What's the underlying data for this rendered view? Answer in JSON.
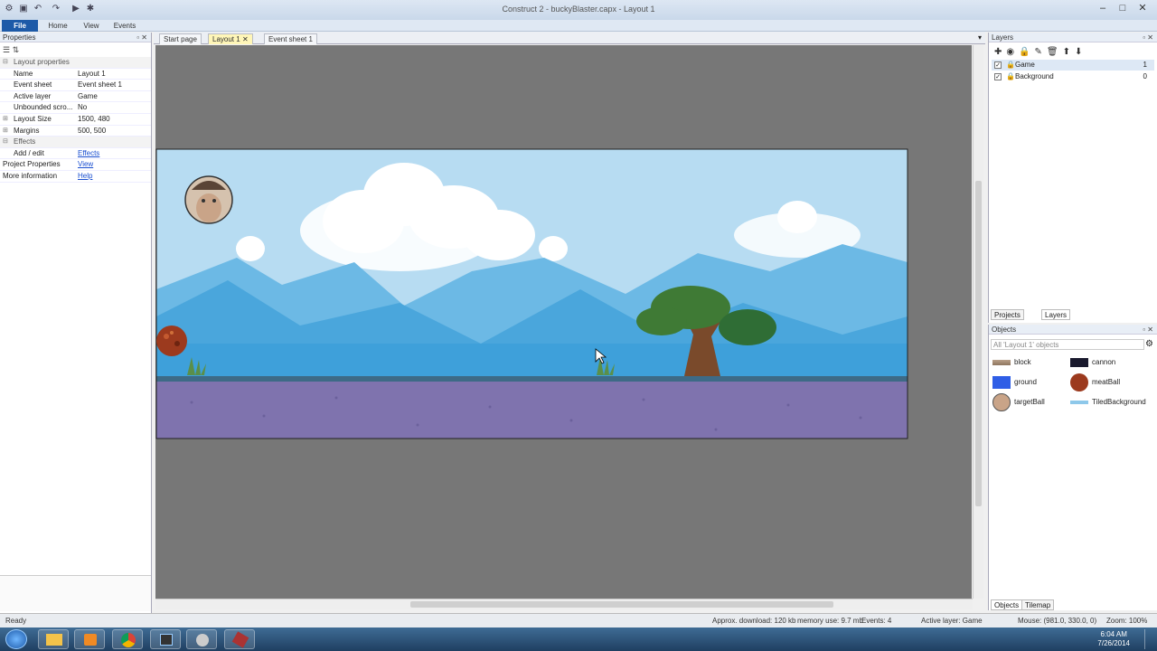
{
  "window": {
    "title": "Construct 2 - buckyBlaster.capx - Layout 1"
  },
  "ribbon": {
    "tabs": [
      "File",
      "Home",
      "View",
      "Events"
    ]
  },
  "properties": {
    "header": "Properties",
    "rows": [
      {
        "key": "Layout properties",
        "value": "",
        "category": true
      },
      {
        "key": "Name",
        "value": "Layout 1"
      },
      {
        "key": "Event sheet",
        "value": "Event sheet 1"
      },
      {
        "key": "Active layer",
        "value": "Game"
      },
      {
        "key": "Unbounded scro...",
        "value": "No"
      },
      {
        "key": "Layout Size",
        "value": "1500, 480"
      },
      {
        "key": "Margins",
        "value": "500, 500"
      },
      {
        "key": "Effects",
        "value": "",
        "category": true
      },
      {
        "key": "Add / edit",
        "value": "Effects",
        "link": true
      },
      {
        "key": "Project Properties",
        "value": "View",
        "link": true
      },
      {
        "key": "More information",
        "value": "Help",
        "link": true
      }
    ]
  },
  "doc_tabs": [
    "Start page",
    "Layout 1",
    "Event sheet 1"
  ],
  "layers": {
    "header": "Layers",
    "items": [
      {
        "name": "Game",
        "index": "1"
      },
      {
        "name": "Background",
        "index": "0"
      }
    ],
    "bottom_tabs": [
      "Projects",
      "Layers"
    ]
  },
  "objects": {
    "header": "Objects",
    "filter": "All 'Layout 1' objects",
    "items": [
      {
        "name": "block",
        "icon": "block-icon"
      },
      {
        "name": "cannon",
        "icon": "cannon-icon"
      },
      {
        "name": "ground",
        "icon": "ground-icon"
      },
      {
        "name": "meatBall",
        "icon": "meatball-icon"
      },
      {
        "name": "targetBall",
        "icon": "targetball-icon"
      },
      {
        "name": "TiledBackground",
        "icon": "tiledbackground-icon"
      }
    ],
    "bottom_tabs": [
      "Objects",
      "Tilemap"
    ]
  },
  "status": {
    "ready": "Ready",
    "download": "Approx. download: 120 kb",
    "memory": "memory use: 9.7 mb",
    "events": "Events: 4",
    "active_layer": "Active layer: Game",
    "mouse": "Mouse: (981.0, 330.0, 0)",
    "zoom": "Zoom: 100%"
  },
  "taskbar": {
    "time": "6:04 AM",
    "date": "7/26/2014"
  },
  "colors": {
    "sky": "#a6d5f0",
    "ground": "#7f73ae",
    "file_tab": "#1d5aa8"
  }
}
